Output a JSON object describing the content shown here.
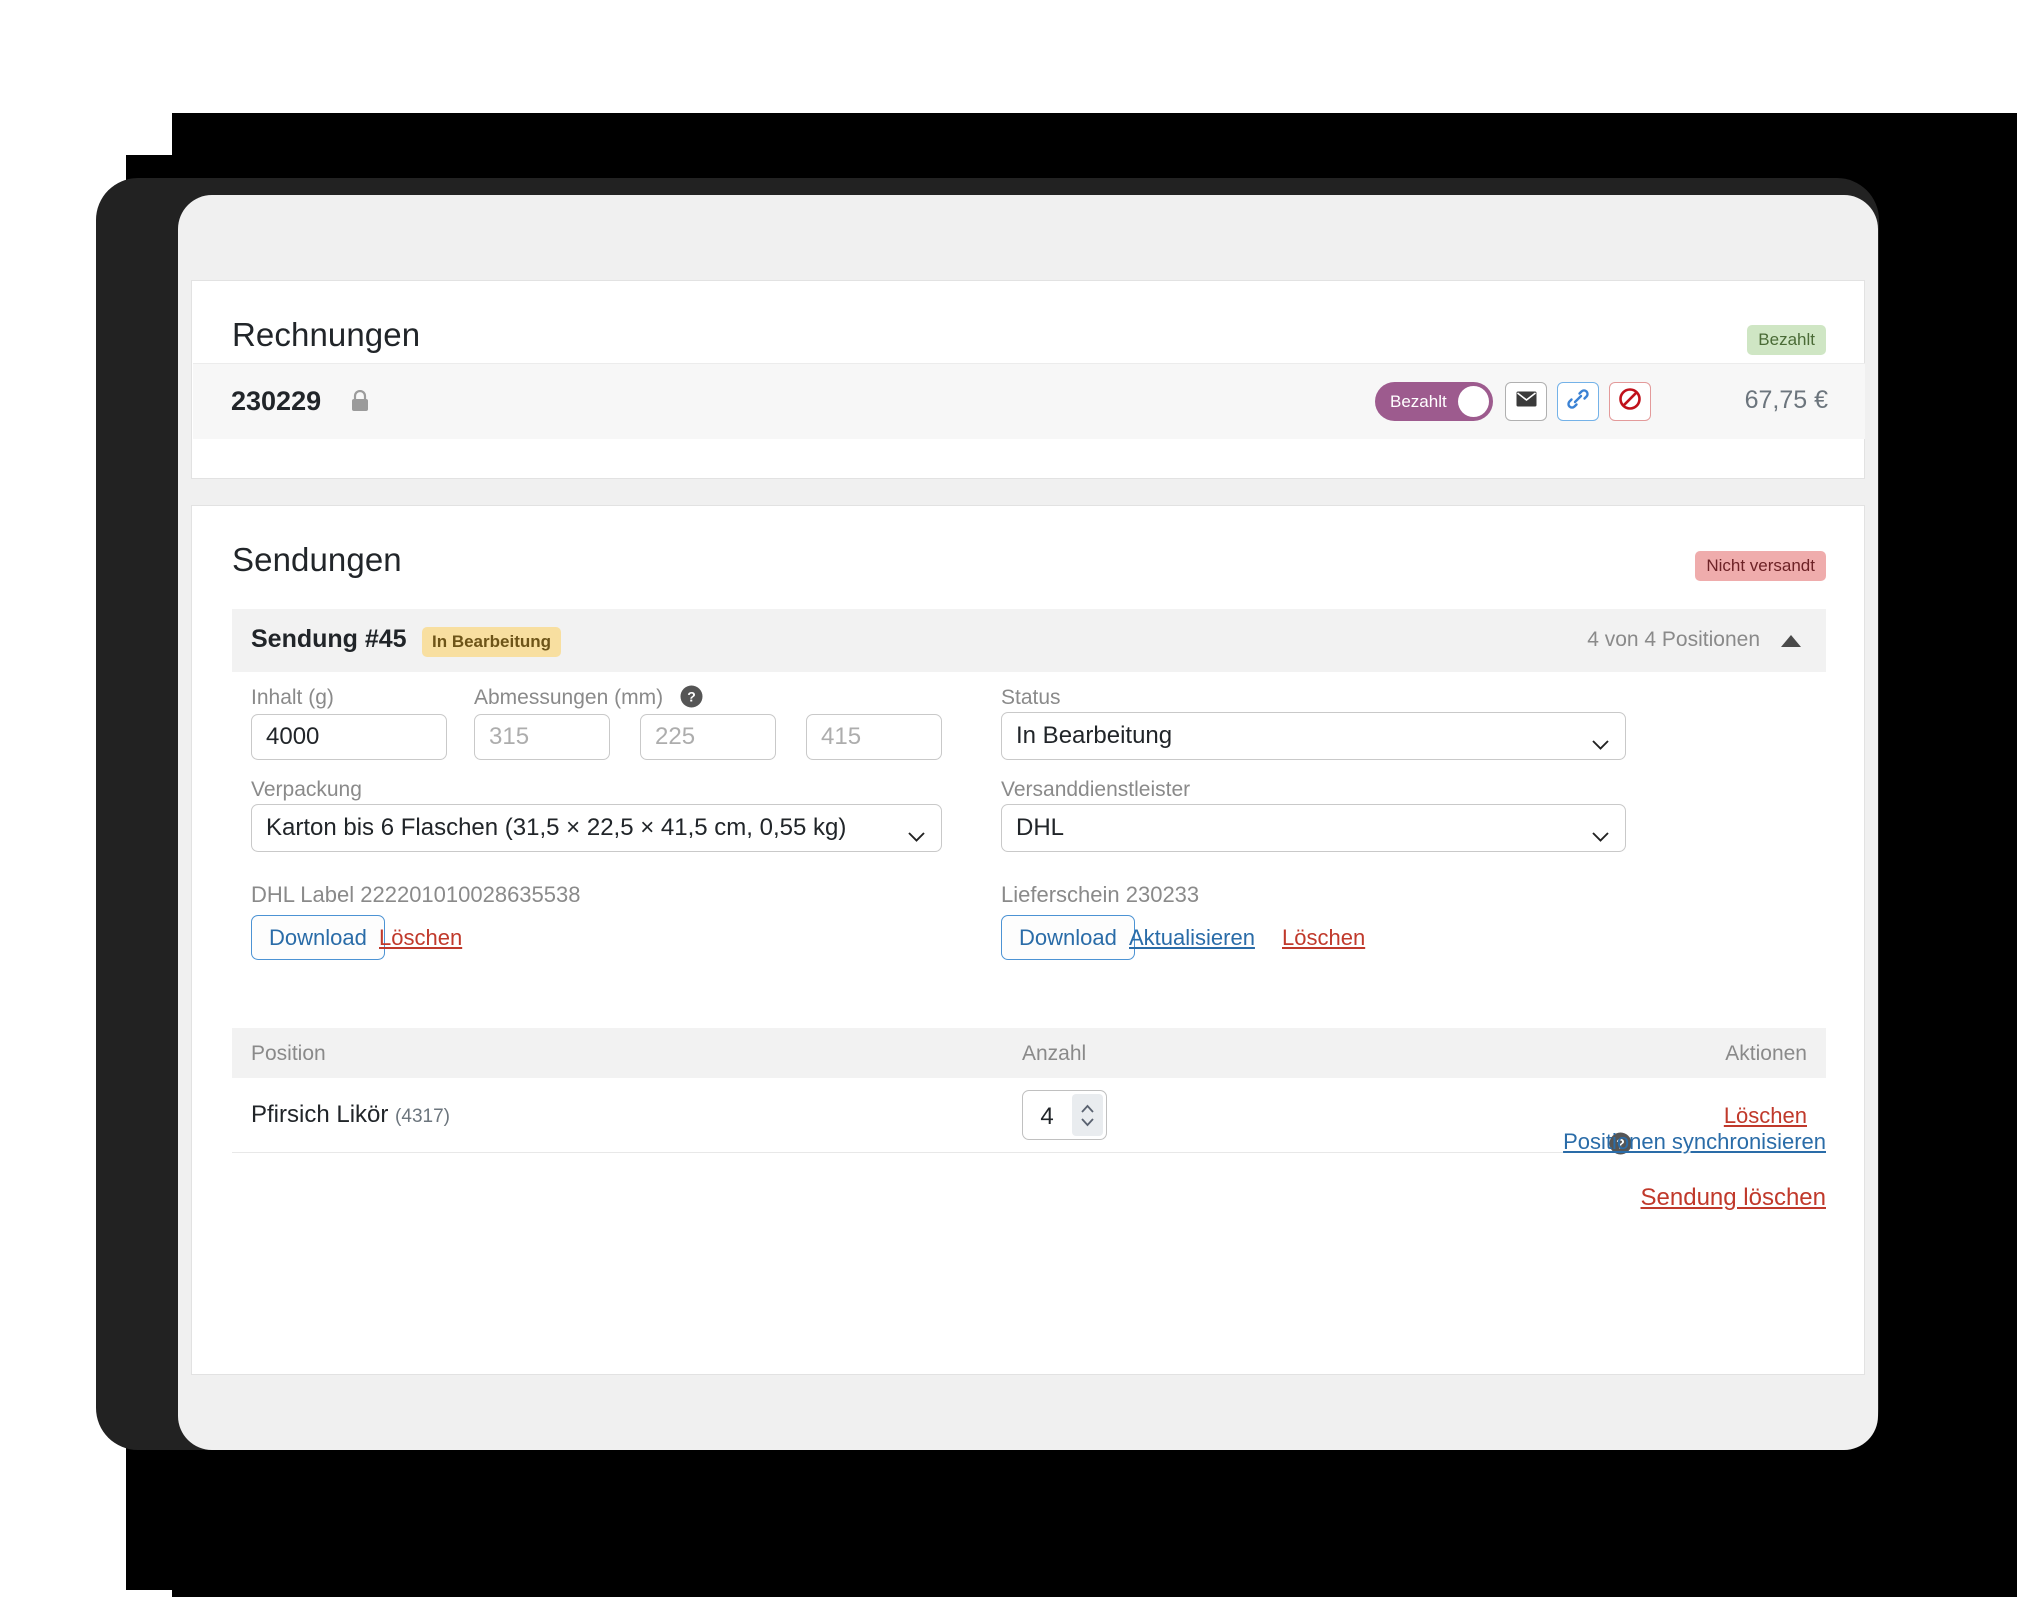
{
  "invoices": {
    "title": "Rechnungen",
    "status_badge": "Bezahlt",
    "row": {
      "number": "230229",
      "lock_icon": "lock-icon",
      "toggle_label": "Bezahlt",
      "mail_icon": "envelope-icon",
      "link_icon": "link-icon",
      "block_icon": "block-icon",
      "amount": "67,75 €"
    }
  },
  "shipments": {
    "title": "Sendungen",
    "status_badge": "Nicht versandt",
    "header": {
      "title": "Sendung #45",
      "badge": "In Bearbeitung",
      "count": "4 von 4 Positionen",
      "collapse_icon": "caret-up-icon"
    },
    "form": {
      "weight_label": "Inhalt (g)",
      "weight_value": "4000",
      "dimensions_label": "Abmessungen (mm)",
      "dimensions_help_icon": "help-circle-icon",
      "dim_length_placeholder": "315",
      "dim_width_placeholder": "225",
      "dim_height_placeholder": "415",
      "status_label": "Status",
      "status_value": "In Bearbeitung",
      "packaging_label": "Verpackung",
      "packaging_value": "Karton bis 6 Flaschen (31,5 × 22,5 × 41,5 cm, 0,55 kg)",
      "carrier_label": "Versanddienstleister",
      "carrier_value": "DHL"
    },
    "documents": {
      "label_doc_title": "DHL Label 222201010028635538",
      "label_doc_download": "Download",
      "label_doc_delete": "Löschen",
      "delivery_note_title": "Lieferschein 230233",
      "delivery_note_download": "Download",
      "delivery_note_update": "Aktualisieren",
      "delivery_note_delete": "Löschen"
    },
    "table": {
      "columns": [
        "Position",
        "Anzahl",
        "Aktionen"
      ],
      "rows": [
        {
          "name": "Pfirsich Likör",
          "sku": "(4317)",
          "quantity": "4",
          "action": "Löschen"
        }
      ]
    },
    "footer": {
      "sync_help_icon": "help-circle-icon",
      "sync_link": "Positionen synchronisieren",
      "delete_link": "Sendung löschen"
    }
  },
  "colors": {
    "accent_blue": "#2a6ca8",
    "danger_red": "#c0392b",
    "toggle_purple": "#9d5b8e",
    "badge_green_bg": "#cfe6c4",
    "badge_red_bg": "#efacac",
    "badge_yellow_bg": "#f8dfa0"
  }
}
